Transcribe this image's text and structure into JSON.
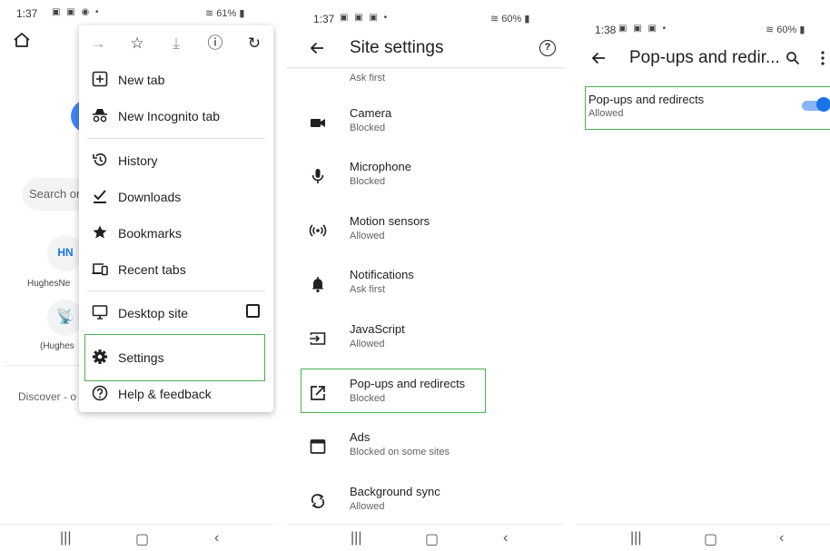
{
  "colors": {
    "highlight": "#4caf50",
    "accent": "#1a73e8",
    "toggle_track": "#8ab4f8"
  },
  "panel1": {
    "status": {
      "time": "1:37",
      "battery": "61%"
    },
    "background": {
      "search_placeholder": "Search or",
      "tile1_text": "HN",
      "tile1_label": "HughesNe",
      "tile2_label": "(Hughes",
      "discover": "Discover - o"
    },
    "menu": {
      "toolbar": [
        {
          "name": "forward-icon",
          "glyph": "→"
        },
        {
          "name": "star-icon",
          "glyph": "☆"
        },
        {
          "name": "download-icon",
          "glyph": "⤓"
        },
        {
          "name": "info-icon",
          "glyph": "ⓘ"
        },
        {
          "name": "refresh-icon",
          "glyph": "↻"
        }
      ],
      "items": {
        "new_tab": "New tab",
        "new_incognito_tab": "New Incognito tab",
        "history": "History",
        "downloads": "Downloads",
        "bookmarks": "Bookmarks",
        "recent_tabs": "Recent tabs",
        "desktop_site": "Desktop site",
        "settings": "Settings",
        "help_feedback": "Help & feedback"
      }
    }
  },
  "panel2": {
    "status": {
      "time": "1:37",
      "battery": "60%"
    },
    "title": "Site settings",
    "partial_row_sub": "Ask first",
    "rows": [
      {
        "title": "Camera",
        "sub": "Blocked"
      },
      {
        "title": "Microphone",
        "sub": "Blocked"
      },
      {
        "title": "Motion sensors",
        "sub": "Allowed"
      },
      {
        "title": "Notifications",
        "sub": "Ask first"
      },
      {
        "title": "JavaScript",
        "sub": "Allowed"
      },
      {
        "title": "Pop-ups and redirects",
        "sub": "Blocked"
      },
      {
        "title": "Ads",
        "sub": "Blocked on some sites"
      },
      {
        "title": "Background sync",
        "sub": "Allowed"
      }
    ]
  },
  "panel3": {
    "status": {
      "time": "1:38",
      "battery": "60%"
    },
    "title": "Pop-ups and redir...",
    "row_title": "Pop-ups and redirects",
    "row_sub": "Allowed",
    "toggle_on": true
  }
}
